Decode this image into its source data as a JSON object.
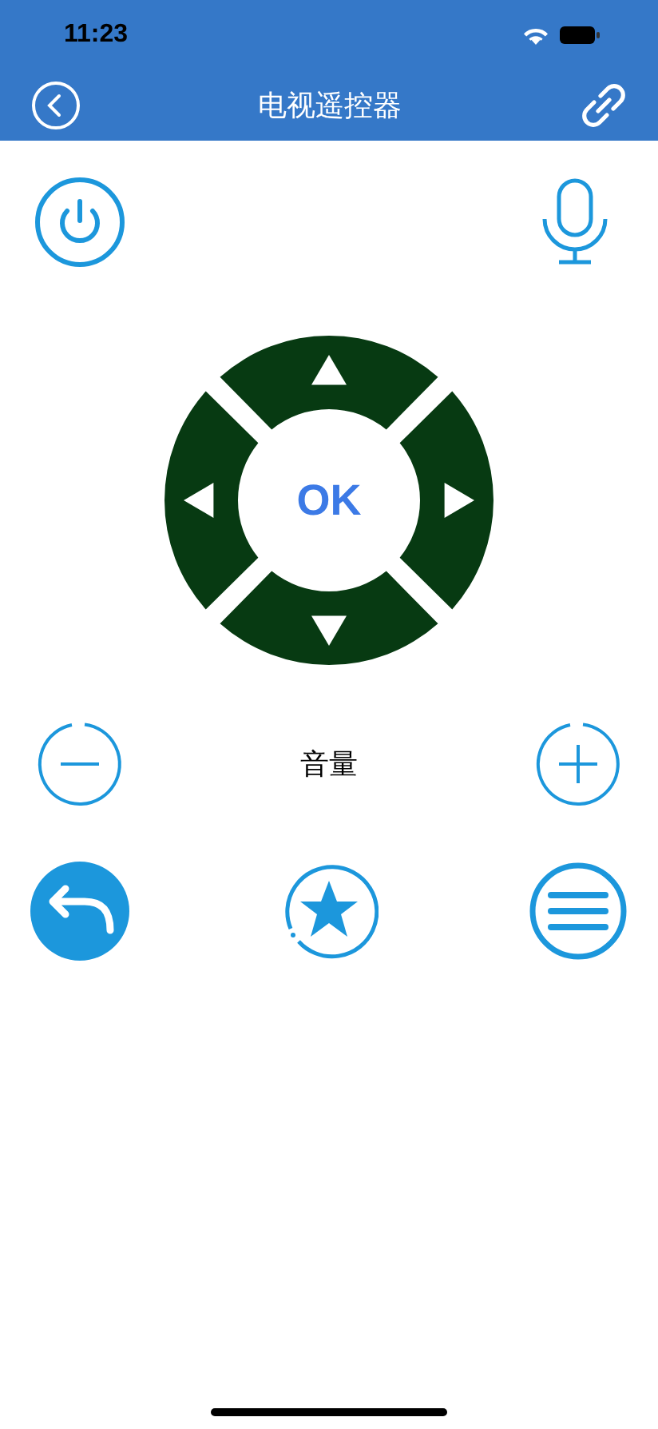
{
  "status_bar": {
    "time": "11:23"
  },
  "nav_bar": {
    "title": "电视遥控器"
  },
  "dpad": {
    "center_label": "OK"
  },
  "volume": {
    "label": "音量"
  }
}
